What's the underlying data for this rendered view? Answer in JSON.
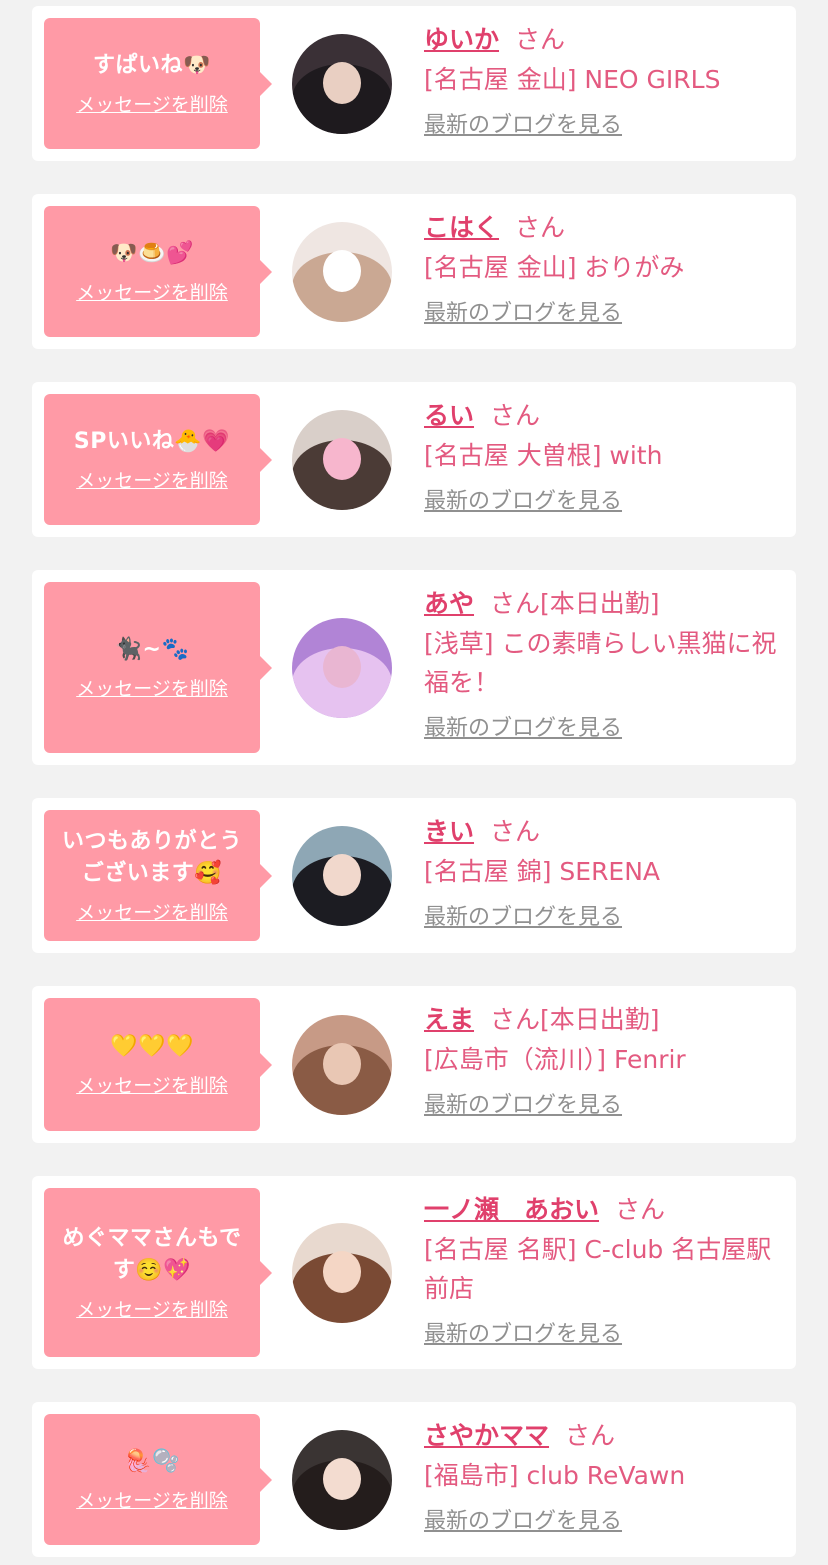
{
  "items": [
    {
      "message": "すぱいね🐶",
      "delete_label": "メッセージを削除",
      "name": "ゆいか",
      "suffix": "さん",
      "shop": "[名古屋 金山] NEO GIRLS",
      "blog_link": "最新のブログを見る",
      "avatar_colors": [
        "#3a3036",
        "#1e1a1e",
        "#e9cfc2"
      ]
    },
    {
      "message": "🐶🍮💕",
      "delete_label": "メッセージを削除",
      "name": "こはく",
      "suffix": "さん",
      "shop": "[名古屋 金山] おりがみ",
      "blog_link": "最新のブログを見る",
      "avatar_colors": [
        "#efe6e2",
        "#caa893",
        "#ffffff"
      ]
    },
    {
      "message": "SPいいね🐣💗",
      "delete_label": "メッセージを削除",
      "name": "るい",
      "suffix": "さん",
      "shop": "[名古屋 大曽根] with",
      "blog_link": "最新のブログを見る",
      "avatar_colors": [
        "#d9cfc9",
        "#4b3b36",
        "#f7b6cd"
      ]
    },
    {
      "message": "🐈‍⬛~🐾",
      "delete_label": "メッセージを削除",
      "name": "あや",
      "suffix": "さん",
      "tag": "[本日出勤]",
      "shop": "[浅草] この素晴らしい黒猫に祝福を！",
      "blog_link": "最新のブログを見る",
      "avatar_colors": [
        "#b184d6",
        "#e6c2f0",
        "#e9b6d2"
      ]
    },
    {
      "message": "いつもありがとうございます🥰",
      "delete_label": "メッセージを削除",
      "name": "きい",
      "suffix": "さん",
      "shop": "[名古屋 錦] SERENA",
      "blog_link": "最新のブログを見る",
      "avatar_colors": [
        "#8ea7b5",
        "#1c1c22",
        "#f1d8cc"
      ]
    },
    {
      "message": "💛💛💛",
      "delete_label": "メッセージを削除",
      "name": "えま",
      "suffix": "さん",
      "tag": "[本日出勤]",
      "shop": "[広島市（流川）] Fenrir",
      "blog_link": "最新のブログを見る",
      "avatar_colors": [
        "#c79a86",
        "#8a5b45",
        "#e9c7b4"
      ]
    },
    {
      "message": "めぐママさんもです☺️💖",
      "delete_label": "メッセージを削除",
      "name": "一ノ瀬　あおい",
      "suffix": "さん",
      "shop": "[名古屋 名駅] C-club 名古屋駅前店",
      "blog_link": "最新のブログを見る",
      "avatar_colors": [
        "#e8d9cf",
        "#7a4a34",
        "#f4d6c5"
      ]
    },
    {
      "message": "🪼🫧",
      "delete_label": "メッセージを削除",
      "name": "さやかママ",
      "suffix": "さん",
      "shop": "[福島市] club ReVawn",
      "blog_link": "最新のブログを見る",
      "avatar_colors": [
        "#3a3433",
        "#241d1c",
        "#f3dcd0"
      ]
    }
  ]
}
